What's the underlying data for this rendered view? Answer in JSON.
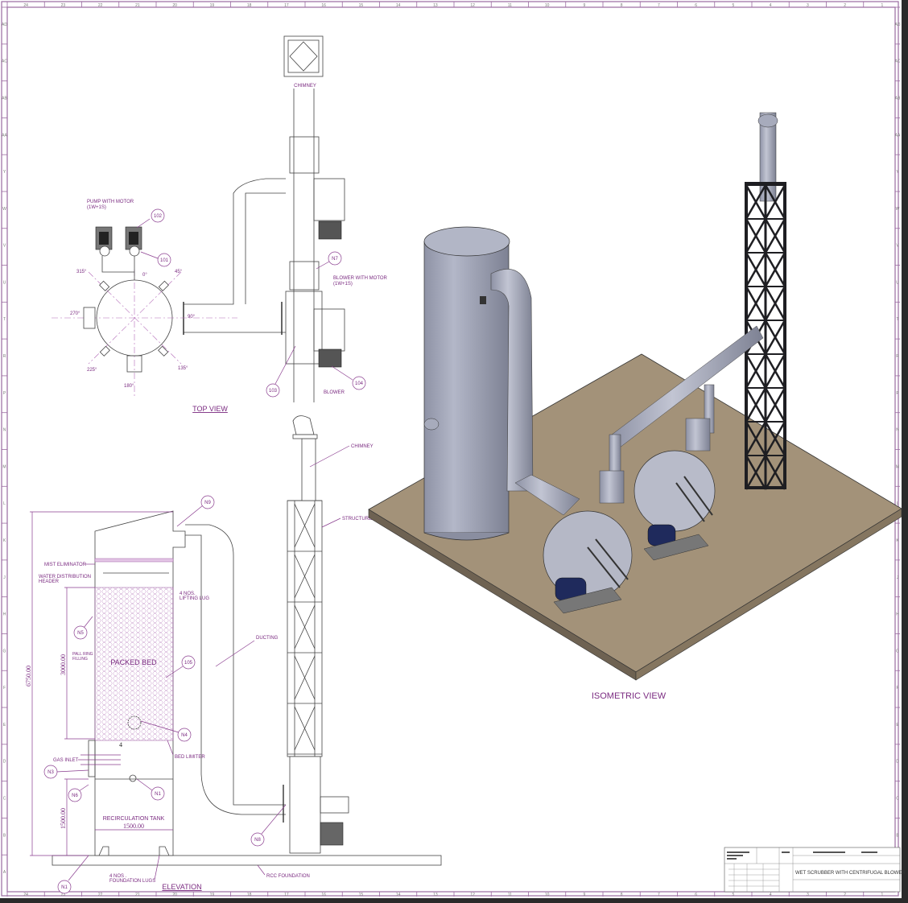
{
  "drawing": {
    "title": "WET SCRUBBER WITH CENTRIFUGAL BLOWER",
    "colors": {
      "annotation": "#7a2a80",
      "frame": "#9a6aa0",
      "vessel": "#a2a6b8",
      "platform": "#a39279",
      "structure": "#1e1e22",
      "motor": "#1f2a5c"
    }
  },
  "ruler": {
    "columns": [
      "24",
      "23",
      "22",
      "21",
      "20",
      "19",
      "18",
      "17",
      "16",
      "15",
      "14",
      "13",
      "12",
      "11",
      "10",
      "9",
      "8",
      "7",
      "6",
      "5",
      "4",
      "3",
      "2",
      "1"
    ],
    "rows": [
      "AD",
      "AC",
      "AB",
      "AA",
      "Y",
      "W",
      "V",
      "U",
      "T",
      "R",
      "P",
      "N",
      "M",
      "L",
      "K",
      "J",
      "H",
      "G",
      "F",
      "E",
      "D",
      "C",
      "B",
      "A"
    ]
  },
  "top_view": {
    "title": "TOP VIEW",
    "chimney": "CHIMNEY",
    "pump": "PUMP WITH MOTOR",
    "pump_config": "(1W+1S)",
    "blower_motor": "BLOWER WITH MOTOR",
    "blower_config": "(1W+1S)",
    "blower": "BLOWER",
    "tags": [
      "102",
      "101",
      "N7",
      "103",
      "104"
    ],
    "angles": [
      "0°",
      "45°",
      "90°",
      "135°",
      "180°",
      "225°",
      "270°",
      "315°"
    ]
  },
  "elevation": {
    "title": "ELEVATION",
    "labels": {
      "mist": "MIST ELIMINATOR",
      "water1": "WATER DISTRIBUTION",
      "water2": "HEADER",
      "lug1": "4 NOS.",
      "lug2": "LIFTING LUG",
      "pall1": "PALL RING",
      "pall2": "FILLING",
      "packed": "PACKED BED",
      "ducting": "DUCTING",
      "chimney": "CHIMNEY",
      "structure": "STRUCTURE",
      "bed_limiter": "BED LIMITER",
      "gas_inlet": "GAS INLET",
      "tank": "RECIRCULATION TANK",
      "flug1": "4 NOS .",
      "flug2": "FOUNDATION LUGS",
      "rcc": "RCC FOUNDATION",
      "four": "4"
    },
    "dims": {
      "total": "6750.00",
      "bed": "3000.00",
      "tank_h": "1500.00",
      "tank_w": "1500.00"
    },
    "tags": [
      "N9",
      "N5",
      "105",
      "N4",
      "N3",
      "N6",
      "N1",
      "N1",
      "N8"
    ]
  },
  "isometric": {
    "title": "ISOMETRIC VIEW"
  }
}
